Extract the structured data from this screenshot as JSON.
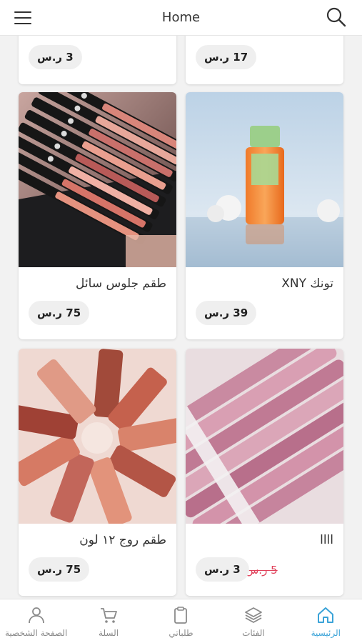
{
  "header": {
    "title": "Home",
    "menu_icon": "hamburger-icon",
    "search_icon": "search-icon"
  },
  "products": [
    {
      "price": "3 ر.س"
    },
    {
      "price": "17 ر.س"
    },
    {
      "name": "طقم جلوس سائل",
      "price": "75 ر.س"
    },
    {
      "name": "تونك XNY",
      "price": "39 ر.س"
    },
    {
      "name": "طقم روج ١٢ لون",
      "price": "75 ر.س"
    },
    {
      "name": "llll",
      "price": "3 ر.س",
      "old_price": "5 ر.س"
    }
  ],
  "bottom_nav": [
    {
      "label": "الرئيسية",
      "icon": "home-icon",
      "active": true
    },
    {
      "label": "الفئات",
      "icon": "layers-icon",
      "active": false
    },
    {
      "label": "طلباتي",
      "icon": "clipboard-icon",
      "active": false
    },
    {
      "label": "السلة",
      "icon": "cart-icon",
      "active": false
    },
    {
      "label": "الصفحة الشخصية",
      "icon": "user-icon",
      "active": false
    }
  ],
  "colors": {
    "accent": "#3aa3d8",
    "sale": "#e0405a"
  }
}
